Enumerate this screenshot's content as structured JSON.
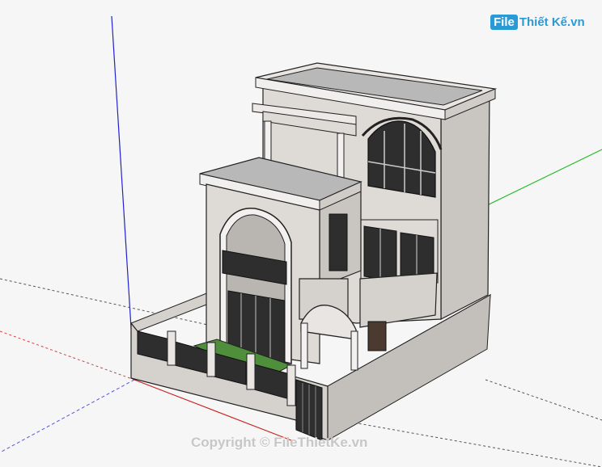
{
  "brand": {
    "logo_file": "File",
    "logo_rest": "Thiết Kế.vn"
  },
  "watermark": "Copyright © FileThietKe.vn",
  "colors": {
    "background": "#f6f6f6",
    "wall": "#dedad6",
    "wall_shadow": "#c9c5c1",
    "wall_dark": "#b9b5b1",
    "roof": "#b8b8b8",
    "glass": "#2e2e2e",
    "grass": "#4f8f3c",
    "axis_blue": "#2222cc",
    "axis_green": "#22bb22",
    "axis_red": "#cc2222"
  }
}
